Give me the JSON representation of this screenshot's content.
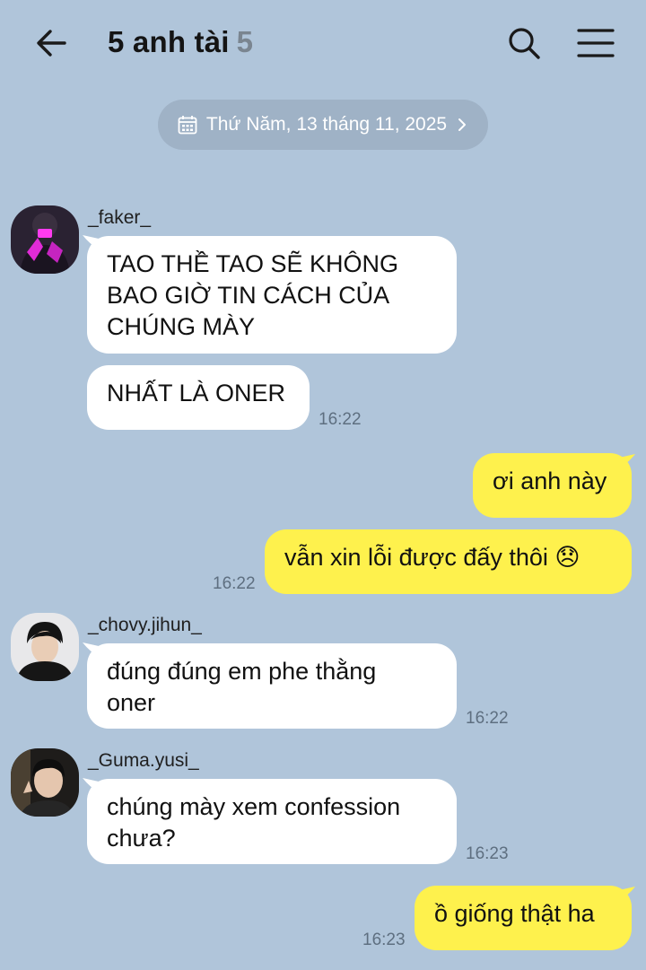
{
  "header": {
    "title": "5 anh tài",
    "member_count": "5",
    "icons": {
      "back": "arrow-left-icon",
      "search": "search-icon",
      "menu": "hamburger-menu-icon"
    }
  },
  "date_divider": {
    "label": "Thứ Năm, 13 tháng 11, 2025",
    "icon": "calendar-icon"
  },
  "colors": {
    "background": "#b0c5da",
    "incoming_bubble": "#ffffff",
    "outgoing_bubble": "#fef14d",
    "date_pill": "#9fb2c6"
  },
  "messages": [
    {
      "sender": "_faker_",
      "text": "TAO THỀ TAO SẼ KHÔNG\nBAO GIỜ TIN CÁCH CỦA\nCHÚNG MÀY"
    },
    {
      "sender": "_faker_",
      "text": "NHẤT LÀ ONER",
      "time": "16:22"
    },
    {
      "sender": "me",
      "text": "ơi anh này"
    },
    {
      "sender": "me",
      "text": "vẫn xin lỗi được đấy thôi 😞",
      "time": "16:22"
    },
    {
      "sender": "_chovy.jihun_",
      "text": "đúng đúng em phe thằng\noner",
      "time": "16:22"
    },
    {
      "sender": "_Guma.yusi_",
      "text": "chúng mày xem confession\nchưa?",
      "time": "16:23"
    },
    {
      "sender": "me",
      "text": "ồ giống thật ha",
      "time": "16:23"
    }
  ]
}
